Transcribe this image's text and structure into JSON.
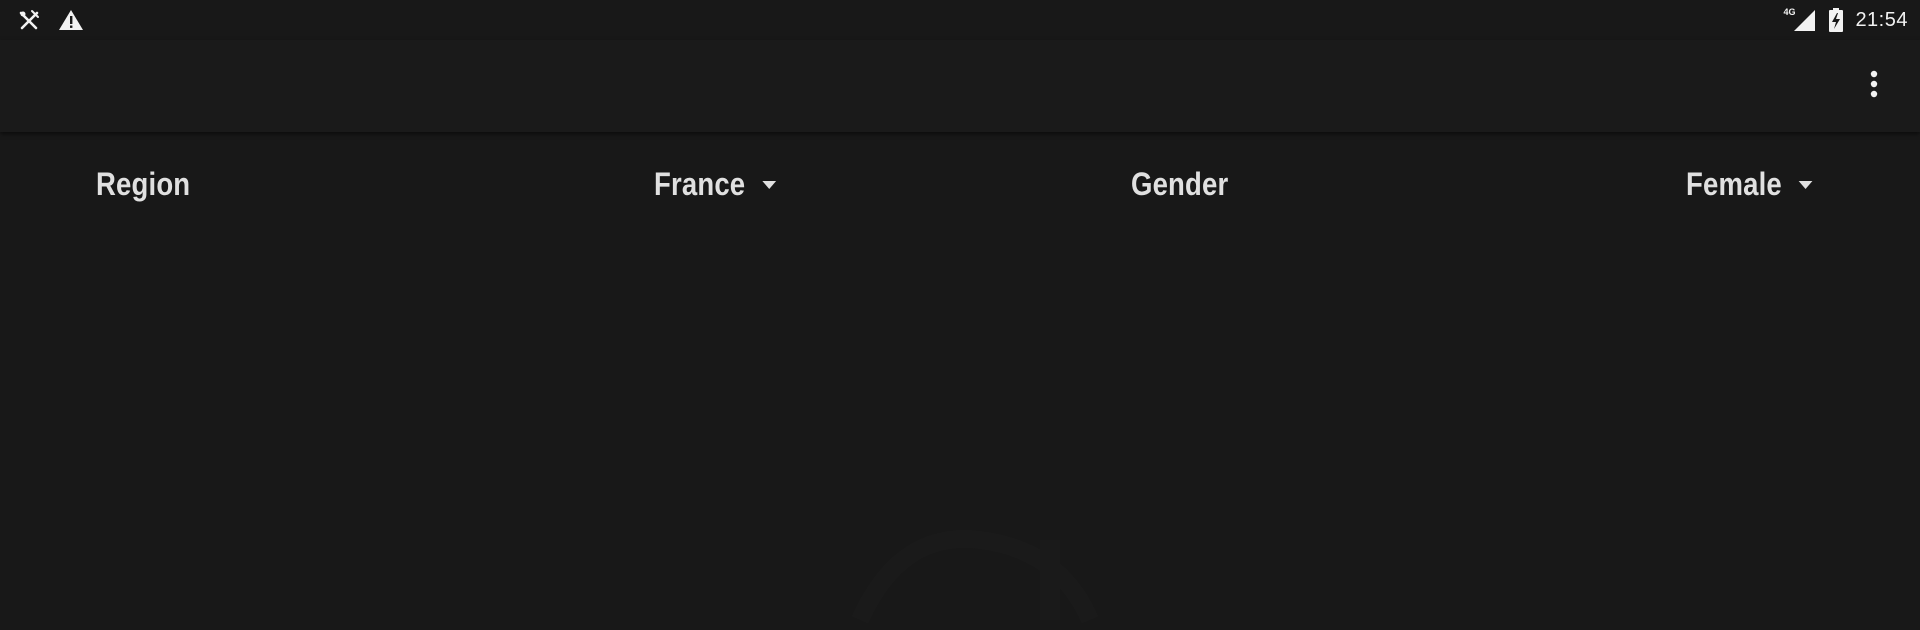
{
  "status_bar": {
    "left_icons": [
      "tools-icon",
      "warning-icon"
    ],
    "network_label": "4G",
    "right_icons": [
      "signal-icon",
      "battery-charging-icon"
    ],
    "time": "21:54"
  },
  "app_bar": {
    "title": "",
    "overflow_icon": "more-vert-icon"
  },
  "filters": {
    "region_label": "Region",
    "region_value": "France",
    "gender_label": "Gender",
    "gender_value": "Female"
  },
  "colors": {
    "background": "#181818",
    "app_bar": "#1a1a1a",
    "text": "#e0e0e0"
  }
}
